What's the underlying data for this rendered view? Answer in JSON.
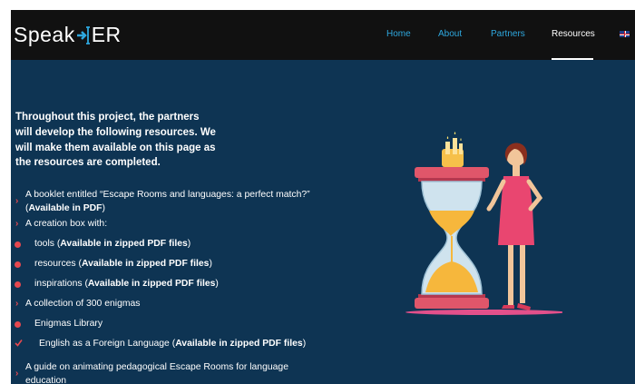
{
  "logo": {
    "text_left": "Speak",
    "text_right": "ER"
  },
  "nav": {
    "items": [
      {
        "label": "Home"
      },
      {
        "label": "About"
      },
      {
        "label": "Partners"
      },
      {
        "label": "Resources",
        "active": true
      }
    ],
    "language_icon": "uk-flag-icon"
  },
  "intro": {
    "lines": [
      "Throughout this project, the partners",
      "will develop the following resources. We",
      "will make them available on this page as",
      "the resources are completed."
    ]
  },
  "resources": [
    {
      "bullet": "chevron",
      "text": "A booklet entitled “Escape Rooms and languages: a perfect match?”",
      "text2": "(",
      "bold2": "Available in PDF",
      "tail2": ")"
    },
    {
      "bullet": "chevron",
      "text": "A creation box with:"
    },
    {
      "bullet": "circle",
      "text": "tools (",
      "bold": "Available in zipped PDF files",
      "tail": ")"
    },
    {
      "bullet": "circle",
      "text": "resources (",
      "bold": "Available in zipped PDF files",
      "tail": ")"
    },
    {
      "bullet": "circle",
      "text": "inspirations (",
      "bold": "Available in zipped PDF files",
      "tail": ")"
    },
    {
      "bullet": "chevron",
      "text": "A collection of 300 enigmas"
    },
    {
      "bullet": "circle",
      "text": "Enigmas Library"
    },
    {
      "bullet": "check",
      "text": "English as a Foreign Language (",
      "bold": "Available in zipped PDF files",
      "tail": ")"
    },
    {
      "bullet": "chevron",
      "text": "A guide on animating pedagogical Escape Rooms for language",
      "text2": "education"
    }
  ],
  "colors": {
    "page_bg": "#0e3453",
    "nav_bg": "#111111",
    "nav_link": "#2ea8df",
    "bullet": "#e6484f",
    "text": "#ffffff"
  },
  "illustration_icon": "hourglass-woman-illustration"
}
